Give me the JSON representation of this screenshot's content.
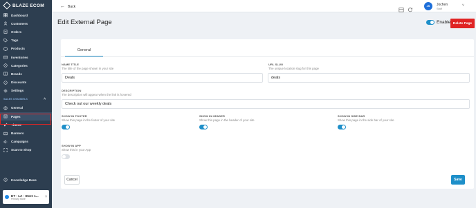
{
  "brand": {
    "name": "BLAZE ECOM"
  },
  "sidebar": {
    "items": [
      {
        "label": "Dashboard",
        "icon": "dashboard-icon"
      },
      {
        "label": "Customers",
        "icon": "users-icon"
      },
      {
        "label": "Orders",
        "icon": "orders-icon"
      },
      {
        "label": "Tags",
        "icon": "tag-icon"
      },
      {
        "label": "Products",
        "icon": "box-icon"
      },
      {
        "label": "Inventories",
        "icon": "inventory-icon"
      },
      {
        "label": "Categories",
        "icon": "category-icon"
      },
      {
        "label": "Brands",
        "icon": "brand-icon"
      },
      {
        "label": "Discounts",
        "icon": "discount-icon"
      },
      {
        "label": "Settings",
        "icon": "gear-icon"
      }
    ],
    "section_label": "SALES CHANNELS",
    "channel_items": [
      {
        "label": "General",
        "icon": "globe-icon"
      },
      {
        "label": "Pages",
        "icon": "pages-icon",
        "active": true
      },
      {
        "label": "Theme",
        "icon": "brush-icon"
      },
      {
        "label": "Banners",
        "icon": "banner-icon"
      },
      {
        "label": "Campaigns",
        "icon": "campaign-icon"
      },
      {
        "label": "Scan to Shop",
        "icon": "scan-icon"
      }
    ],
    "knowledge_base": "Knowledge Base",
    "store": {
      "name": "DT - LA - Store 1...",
      "sub": "Primary Store"
    }
  },
  "topbar": {
    "back_label": "Back",
    "avatar_initials": "JS",
    "user_name": "Jochen",
    "user_role": "Staff"
  },
  "page": {
    "title": "Edit External Page",
    "enabled_label": "Enabled",
    "enabled": true,
    "delete_label": "Delete Page"
  },
  "form": {
    "tab_general": "General",
    "name_title_label": "NAME TITLE",
    "name_title_hint": "The title of the page shown in your site",
    "name_title_value": "Deals",
    "url_slug_label": "URL SLUG",
    "url_slug_hint": "The unique location slug for this page",
    "url_slug_value": "deals",
    "description_label": "DESCRIPTION",
    "description_hint": "The description will appear when the link is hovered",
    "description_value": "Check out our weekly deals",
    "show_in_footer_label": "SHOW IN FOOTER",
    "show_in_footer_hint": "Show this page in the footer of your site",
    "show_in_footer": true,
    "show_in_header_label": "SHOW IN HEADER",
    "show_in_header_hint": "Show this page in the header of your site",
    "show_in_header": true,
    "show_in_side_bar_label": "SHOW IN SIDE BAR",
    "show_in_side_bar_hint": "Show this page in the side bar of your site",
    "show_in_side_bar": true,
    "show_in_app_label": "SHOW IN APP",
    "show_in_app_hint": "Show this in your App",
    "show_in_app": false,
    "cancel_label": "Cancel",
    "save_label": "Save"
  },
  "colors": {
    "sidebar_bg": "#2d3e50",
    "accent": "#1e8fc9",
    "danger": "#e02424",
    "avatar": "#1e6fd9"
  }
}
